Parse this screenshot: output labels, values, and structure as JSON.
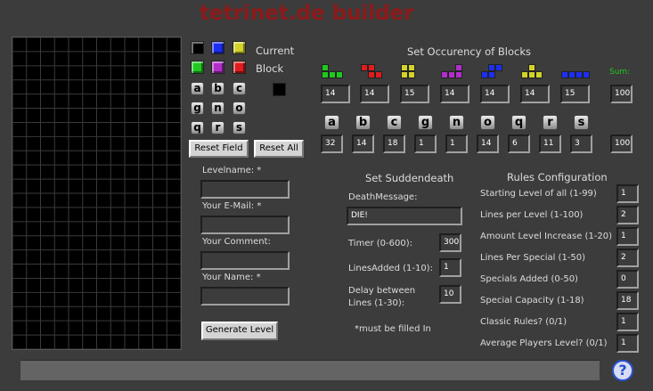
{
  "title": "tetrinet.de builder",
  "palette": {
    "current_label": "Current",
    "block_label": "Block",
    "colors": [
      "#000000",
      "#1c2ff0",
      "#d2d22a",
      "#1fc81f",
      "#b02fc8",
      "#e01c1c"
    ],
    "current_color": "#000000",
    "specials": [
      "a",
      "b",
      "c",
      "g",
      "n",
      "o",
      "q",
      "r",
      "s"
    ]
  },
  "buttons": {
    "reset_field": "Reset Field",
    "reset_all": "Reset All",
    "generate_level": "Generate Level"
  },
  "form": {
    "levelname_label": "Levelname: *",
    "email_label": "Your E-Mail: *",
    "comment_label": "Your Comment:",
    "name_label": "Your Name: *",
    "required_note": "*must be filled In"
  },
  "occurrency": {
    "heading": "Set Occurency of Blocks",
    "sum_label": "Sum:",
    "block_colors": [
      "#1fc81f",
      "#e01c1c",
      "#d2d22a",
      "#b02fc8",
      "#1c2ff0",
      "#d2d22a",
      "#1c2ff0"
    ],
    "block_values": [
      "14",
      "14",
      "15",
      "14",
      "14",
      "14",
      "15"
    ],
    "block_sum": "100",
    "special_letters": [
      "a",
      "b",
      "c",
      "g",
      "n",
      "o",
      "q",
      "r",
      "s"
    ],
    "special_values": [
      "32",
      "14",
      "18",
      "1",
      "1",
      "14",
      "6",
      "11",
      "3"
    ],
    "special_sum": "100"
  },
  "suddendeath": {
    "heading": "Set Suddendeath",
    "death_message_label": "DeathMessage:",
    "death_message_value": "DIE!",
    "timer_label": "Timer (0-600):",
    "timer_value": "300",
    "lines_added_label": "LinesAdded (1-10):",
    "lines_added_value": "1",
    "delay_label_1": "Delay between",
    "delay_label_2": "Lines (1-30):",
    "delay_value": "10"
  },
  "rules": {
    "heading": "Rules Configuration",
    "items": [
      {
        "label": "Starting Level of all (1-99)",
        "value": "1"
      },
      {
        "label": "Lines per Level (1-100)",
        "value": "2"
      },
      {
        "label": "Amount Level Increase (1-20)",
        "value": "1"
      },
      {
        "label": "Lines Per Special (1-50)",
        "value": "2"
      },
      {
        "label": "Specials Added (0-50)",
        "value": "0"
      },
      {
        "label": "Special Capacity (1-18)",
        "value": "18"
      },
      {
        "label": "Classic Rules? (0/1)",
        "value": "1"
      },
      {
        "label": "Average Players Level? (0/1)",
        "value": "1"
      }
    ]
  },
  "help_icon": "help-icon",
  "help_glyph": "?"
}
